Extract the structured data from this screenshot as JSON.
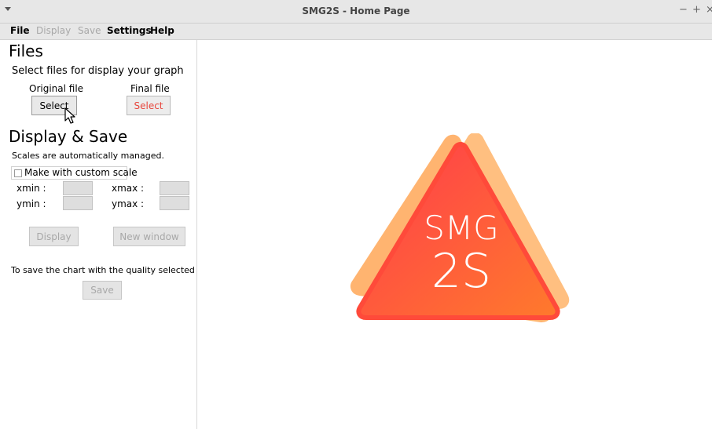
{
  "window": {
    "title": "SMG2S - Home Page",
    "controls": {
      "minimize": "−",
      "maximize": "+",
      "close": "×"
    }
  },
  "menu": {
    "file": "File",
    "display": "Display",
    "save": "Save",
    "settings": "Settings",
    "help": "Help"
  },
  "files": {
    "heading": "Files",
    "subtitle": "Select files for display your graph",
    "original_label": "Original file",
    "final_label": "Final file",
    "original_button": "Select",
    "final_button": "Select"
  },
  "display_save": {
    "heading": "Display & Save",
    "note": "Scales are automatically managed.",
    "custom_scale_label": "Make with custom scale",
    "custom_scale_checked": false,
    "xmin_label": "xmin :",
    "xmax_label": "xmax :",
    "ymin_label": "ymin :",
    "ymax_label": "ymax :",
    "xmin_value": "",
    "xmax_value": "",
    "ymin_value": "",
    "ymax_value": "",
    "display_button": "Display",
    "new_window_button": "New window",
    "save_note": "To save the chart with the quality selected",
    "save_button": "Save"
  },
  "logo": {
    "line1": "SMG",
    "line2": "2S"
  },
  "colors": {
    "accent_red": "#e8463d",
    "logo_orange_light": "#ffb56b",
    "logo_orange": "#ff8a3d",
    "logo_red": "#ff3b3b",
    "logo_pink": "#f7245a"
  }
}
